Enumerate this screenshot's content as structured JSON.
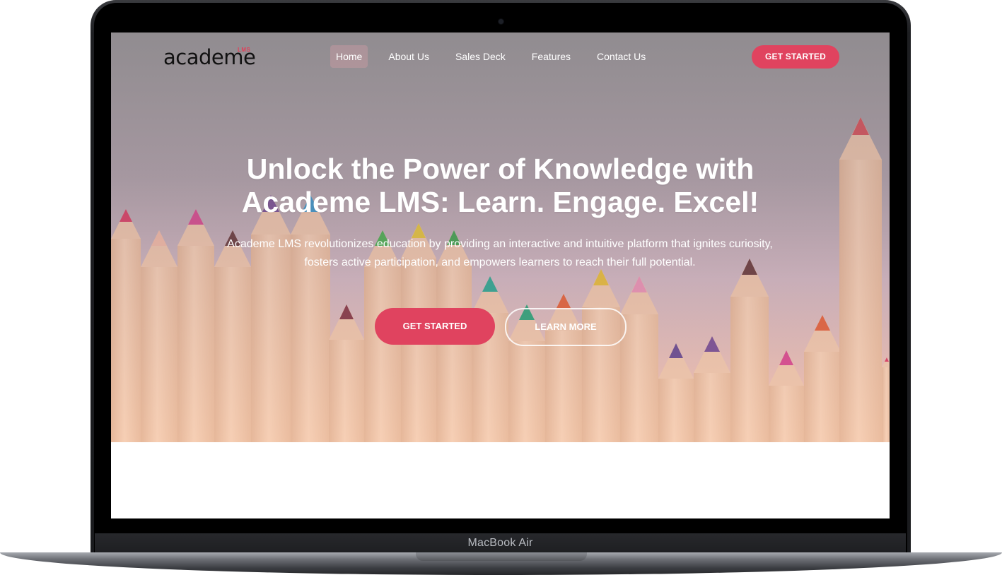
{
  "device": {
    "label": "MacBook Air"
  },
  "nav": {
    "logo_text": "academe",
    "logo_badge": "LMS",
    "items": [
      {
        "label": "Home",
        "active": true
      },
      {
        "label": "About Us",
        "active": false
      },
      {
        "label": "Sales Deck",
        "active": false
      },
      {
        "label": "Features",
        "active": false
      },
      {
        "label": "Contact Us",
        "active": false
      }
    ],
    "cta_label": "GET STARTED"
  },
  "hero": {
    "headline_line1": "Unlock the Power of Knowledge with",
    "headline_line2": "Academe LMS: Learn. Engage. Excel!",
    "subtext_line1": "Academe LMS revolutionizes education by providing an interactive and intuitive platform that ignites curiosity,",
    "subtext_line2": "fosters active participation, and empowers learners to reach their full potential.",
    "primary_button": "GET STARTED",
    "secondary_button": "LEARN MORE"
  },
  "colors": {
    "accent": "#e0435f",
    "text_on_hero": "#ffffff"
  }
}
